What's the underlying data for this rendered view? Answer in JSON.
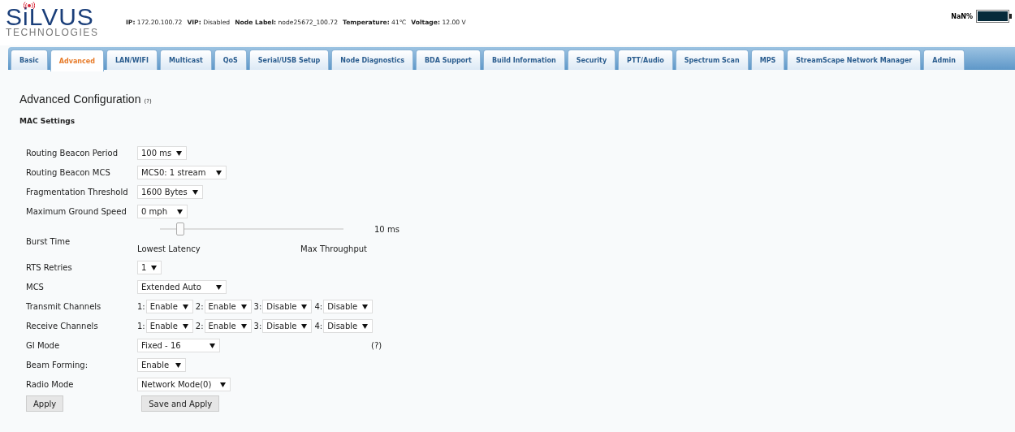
{
  "logo": {
    "name": "SiLVUS",
    "subtitle": "TECHNOLOGIES"
  },
  "status": [
    {
      "label": "IP:",
      "value": "172.20.100.72"
    },
    {
      "label": "VIP:",
      "value": "Disabled"
    },
    {
      "label": "Node Label:",
      "value": "node25672_100.72"
    },
    {
      "label": "Temperature:",
      "value": "41℃"
    },
    {
      "label": "Voltage:",
      "value": "12.00 V"
    }
  ],
  "battery": {
    "reading": "NaN%"
  },
  "tabs": [
    {
      "label": "Basic",
      "selected": false
    },
    {
      "label": "Advanced",
      "selected": true
    },
    {
      "label": "LAN/WIFI",
      "selected": false
    },
    {
      "label": "Multicast",
      "selected": false
    },
    {
      "label": "QoS",
      "selected": false
    },
    {
      "label": "Serial/USB Setup",
      "selected": false
    },
    {
      "label": "Node Diagnostics",
      "selected": false
    },
    {
      "label": "BDA Support",
      "selected": false
    },
    {
      "label": "Build Information",
      "selected": false
    },
    {
      "label": "Security",
      "selected": false
    },
    {
      "label": "PTT/Audio",
      "selected": false
    },
    {
      "label": "Spectrum Scan",
      "selected": false
    },
    {
      "label": "MPS",
      "selected": false
    },
    {
      "label": "StreamScape Network Manager",
      "selected": false
    },
    {
      "label": "Admin",
      "selected": false
    }
  ],
  "page_title": "Advanced Configuration",
  "page_help": "(?)",
  "section": "MAC Settings",
  "settings": [
    {
      "kind": "select",
      "label": "Routing Beacon Period",
      "value": "100 ms"
    },
    {
      "kind": "select",
      "label": "Routing Beacon MCS",
      "value": "MCS0: 1 stream"
    },
    {
      "kind": "select",
      "label": "Fragmentation Threshold",
      "value": "1600 Bytes"
    },
    {
      "kind": "select",
      "label": "Maximum Ground Speed",
      "value": "0 mph"
    },
    {
      "kind": "slider",
      "label": "Burst Time",
      "level": 0.11,
      "reading": "10 ms",
      "min_label": "Lowest Latency",
      "max_label": "Max Throughput"
    },
    {
      "kind": "select",
      "label": "RTS Retries",
      "value": "1"
    },
    {
      "kind": "select",
      "label": "MCS",
      "value": "Extended Auto"
    },
    {
      "kind": "channels",
      "label": "Transmit Channels",
      "channels": [
        {
          "index": "1:",
          "value": "Enable"
        },
        {
          "index": "2:",
          "value": "Enable"
        },
        {
          "index": "3:",
          "value": "Disable"
        },
        {
          "index": "4:",
          "value": "Disable"
        }
      ]
    },
    {
      "kind": "channels",
      "label": "Receive Channels",
      "channels": [
        {
          "index": "1:",
          "value": "Enable"
        },
        {
          "index": "2:",
          "value": "Enable"
        },
        {
          "index": "3:",
          "value": "Disable"
        },
        {
          "index": "4:",
          "value": "Disable"
        }
      ]
    },
    {
      "kind": "select",
      "label": "GI Mode",
      "value": "Fixed - 16",
      "help": "(?)"
    },
    {
      "kind": "select",
      "label": "Beam Forming:",
      "value": "Enable"
    },
    {
      "kind": "select",
      "label": "Radio Mode",
      "value": "Network Mode(0)"
    }
  ],
  "buttons": [
    {
      "label": "Apply"
    },
    {
      "label": "Save and Apply"
    }
  ]
}
